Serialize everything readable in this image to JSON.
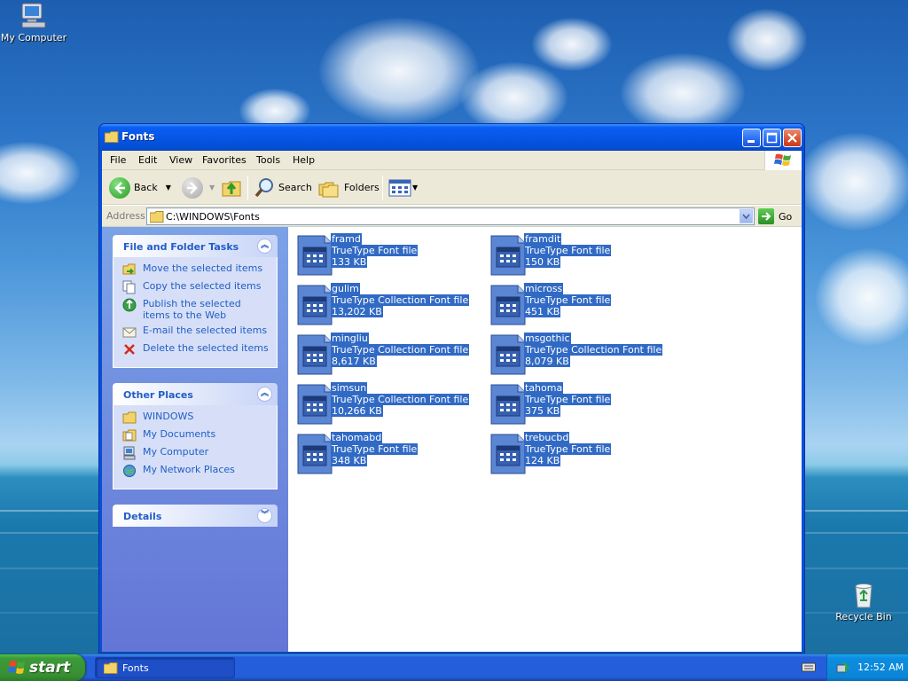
{
  "desktop": {
    "icons": [
      {
        "label": "My Computer",
        "icon": "my-computer-icon"
      },
      {
        "label": "Recycle Bin",
        "icon": "recycle-bin-icon"
      }
    ]
  },
  "window": {
    "title": "Fonts",
    "menu": [
      "File",
      "Edit",
      "View",
      "Favorites",
      "Tools",
      "Help"
    ],
    "toolbar": {
      "back_label": "Back",
      "search_label": "Search",
      "folders_label": "Folders"
    },
    "address": {
      "label": "Address",
      "value": "C:\\WINDOWS\\Fonts",
      "go_label": "Go"
    }
  },
  "taskpane": {
    "file_tasks": {
      "title": "File and Folder Tasks",
      "items": [
        {
          "label": "Move the selected items",
          "icon": "move-icon"
        },
        {
          "label": "Copy the selected items",
          "icon": "copy-icon"
        },
        {
          "label": "Publish the selected items to the Web",
          "icon": "publish-icon"
        },
        {
          "label": "E-mail the selected items",
          "icon": "email-icon"
        },
        {
          "label": "Delete the selected items",
          "icon": "delete-icon"
        }
      ]
    },
    "other_places": {
      "title": "Other Places",
      "items": [
        {
          "label": "WINDOWS",
          "icon": "folder-icon"
        },
        {
          "label": "My Documents",
          "icon": "my-documents-icon"
        },
        {
          "label": "My Computer",
          "icon": "my-computer-icon"
        },
        {
          "label": "My Network Places",
          "icon": "network-places-icon"
        }
      ]
    },
    "details": {
      "title": "Details"
    }
  },
  "files": [
    {
      "name": "framd",
      "type": "TrueType Font file",
      "size": "133 KB"
    },
    {
      "name": "framdit",
      "type": "TrueType Font file",
      "size": "150 KB"
    },
    {
      "name": "gulim",
      "type": "TrueType Collection Font file",
      "size": "13,202 KB"
    },
    {
      "name": "micross",
      "type": "TrueType Font file",
      "size": "451 KB"
    },
    {
      "name": "mingliu",
      "type": "TrueType Collection Font file",
      "size": "8,617 KB"
    },
    {
      "name": "msgothic",
      "type": "TrueType Collection Font file",
      "size": "8,079 KB"
    },
    {
      "name": "simsun",
      "type": "TrueType Collection Font file",
      "size": "10,266 KB"
    },
    {
      "name": "tahoma",
      "type": "TrueType Font file",
      "size": "375 KB"
    },
    {
      "name": "tahomabd",
      "type": "TrueType Font file",
      "size": "348 KB"
    },
    {
      "name": "trebucbd",
      "type": "TrueType Font file",
      "size": "124 KB"
    }
  ],
  "taskbar": {
    "start_label": "start",
    "task_label": "Fonts",
    "clock": "12:52 AM"
  },
  "colors": {
    "selection": "#316ac5",
    "task_link": "#215dc6",
    "titlebar": "#0656e8"
  }
}
